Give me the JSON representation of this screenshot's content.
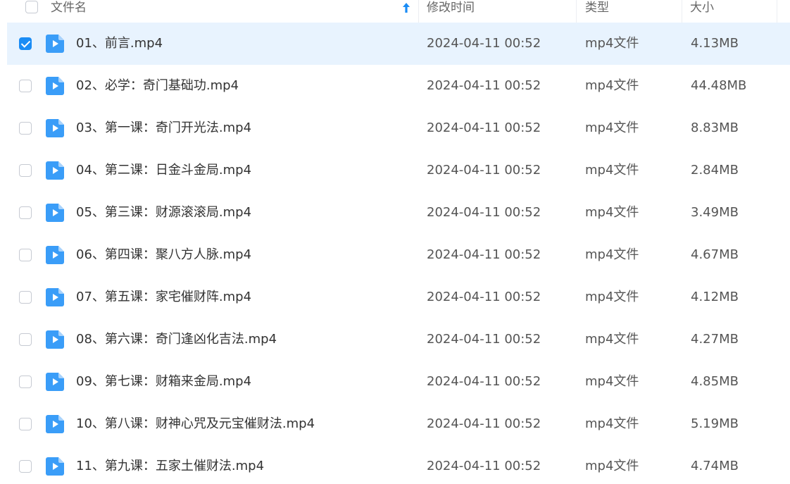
{
  "header": {
    "col_name": "文件名",
    "col_modified": "修改时间",
    "col_type": "类型",
    "col_size": "大小"
  },
  "colors": {
    "accent": "#1a8cf5",
    "selected_row_bg": "#e8f3fe",
    "file_icon_bg": "#3a9df8"
  },
  "files": [
    {
      "name": "01、前言.mp4",
      "modified": "2024-04-11 00:52",
      "type": "mp4文件",
      "size": "4.13MB",
      "selected": true,
      "icon": "video-file-icon"
    },
    {
      "name": "02、必学：奇门基础功.mp4",
      "modified": "2024-04-11 00:52",
      "type": "mp4文件",
      "size": "44.48MB",
      "selected": false,
      "icon": "video-file-icon"
    },
    {
      "name": "03、第一课：奇门开光法.mp4",
      "modified": "2024-04-11 00:52",
      "type": "mp4文件",
      "size": "8.83MB",
      "selected": false,
      "icon": "video-file-icon"
    },
    {
      "name": "04、第二课：日金斗金局.mp4",
      "modified": "2024-04-11 00:52",
      "type": "mp4文件",
      "size": "2.84MB",
      "selected": false,
      "icon": "video-file-icon"
    },
    {
      "name": "05、第三课：财源滚滚局.mp4",
      "modified": "2024-04-11 00:52",
      "type": "mp4文件",
      "size": "3.49MB",
      "selected": false,
      "icon": "video-file-icon"
    },
    {
      "name": "06、第四课：聚八方人脉.mp4",
      "modified": "2024-04-11 00:52",
      "type": "mp4文件",
      "size": "4.67MB",
      "selected": false,
      "icon": "video-file-icon"
    },
    {
      "name": "07、第五课：家宅催财阵.mp4",
      "modified": "2024-04-11 00:52",
      "type": "mp4文件",
      "size": "4.12MB",
      "selected": false,
      "icon": "video-file-icon"
    },
    {
      "name": "08、第六课：奇门逢凶化吉法.mp4",
      "modified": "2024-04-11 00:52",
      "type": "mp4文件",
      "size": "4.27MB",
      "selected": false,
      "icon": "video-file-icon"
    },
    {
      "name": "09、第七课：财箱来金局.mp4",
      "modified": "2024-04-11 00:52",
      "type": "mp4文件",
      "size": "4.85MB",
      "selected": false,
      "icon": "video-file-icon"
    },
    {
      "name": "10、第八课：财神心咒及元宝催财法.mp4",
      "modified": "2024-04-11 00:52",
      "type": "mp4文件",
      "size": "5.19MB",
      "selected": false,
      "icon": "video-file-icon"
    },
    {
      "name": "11、第九课：五家土催财法.mp4",
      "modified": "2024-04-11 00:52",
      "type": "mp4文件",
      "size": "4.74MB",
      "selected": false,
      "icon": "video-file-icon"
    }
  ]
}
